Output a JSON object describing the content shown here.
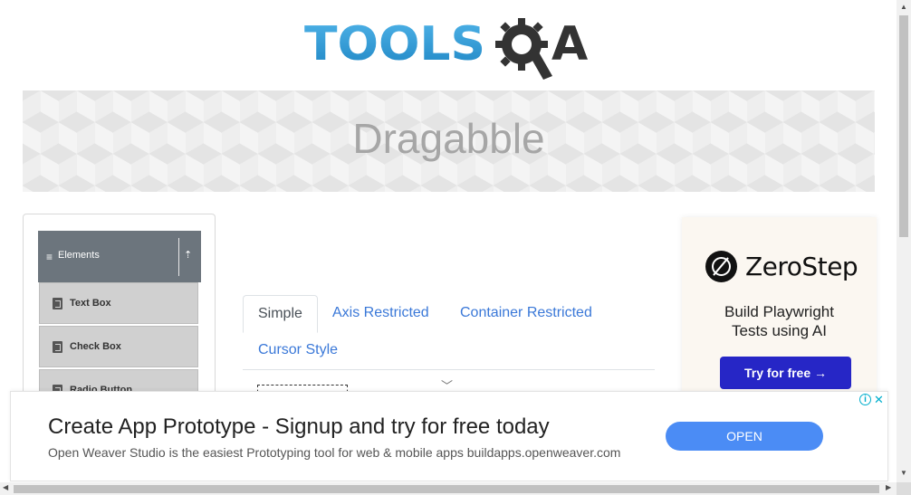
{
  "logo": {
    "text_left": "TOOLS",
    "text_right": "A",
    "color_blue": "#2f9bd6",
    "color_dark": "#333333"
  },
  "banner": {
    "title": "Dragabble"
  },
  "sidebar": {
    "group": {
      "label": "Elements",
      "menu_icon": "hamburger-icon",
      "collapse_icon": "collapse-up-icon"
    },
    "items": [
      {
        "label": "Text Box",
        "icon": "html5-icon"
      },
      {
        "label": "Check Box",
        "icon": "html5-icon"
      },
      {
        "label": "Radio Button",
        "icon": "html5-icon"
      }
    ]
  },
  "tabs": [
    {
      "label": "Simple",
      "active": true
    },
    {
      "label": "Axis Restricted",
      "active": false
    },
    {
      "label": "Container Restricted",
      "active": false
    },
    {
      "label": "Cursor Style",
      "active": false
    }
  ],
  "right_ad": {
    "brand": "ZeroStep",
    "tagline_1": "Build Playwright",
    "tagline_2": "Tests using AI",
    "cta": "Try for free →",
    "cta_color": "#2626c6"
  },
  "bottom_ad": {
    "headline": "Create App Prototype - Signup and try for free today",
    "description": "Open Weaver Studio is the easiest Prototyping tool for web & mobile apps buildapps.openweaver.com",
    "cta": "OPEN",
    "cta_color": "#4b8cf5",
    "info_icon": "i",
    "close_icon": "✕"
  }
}
